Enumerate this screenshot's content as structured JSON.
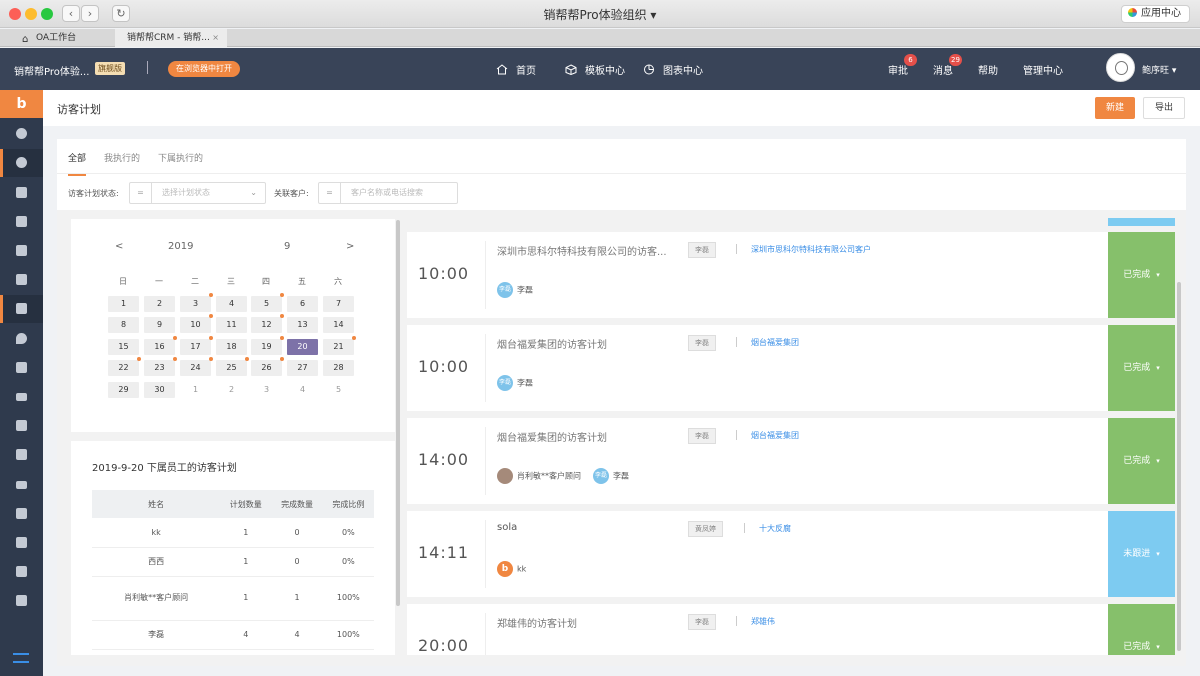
{
  "window": {
    "title": "销帮帮Pro体验组织",
    "app_center": "应用中心"
  },
  "tabs": [
    {
      "label": "OA工作台"
    },
    {
      "label": "销帮帮CRM - 销帮..."
    }
  ],
  "header": {
    "org": "销帮帮Pro体验...",
    "badge": "旗舰版",
    "open_browser": "在浏览器中打开",
    "nav": [
      {
        "label": "首页"
      },
      {
        "label": "模板中心"
      },
      {
        "label": "图表中心"
      }
    ],
    "approval": {
      "label": "审批",
      "count": "6"
    },
    "messages": {
      "label": "消息",
      "count": "29"
    },
    "help": "帮助",
    "admin": "管理中心",
    "user": "鲍序旺"
  },
  "page": {
    "title": "访客计划",
    "new_btn": "新建",
    "export_btn": "导出"
  },
  "view_tabs": [
    "全部",
    "我执行的",
    "下属执行的"
  ],
  "filters": {
    "status_label": "访客计划状态:",
    "status_placeholder": "选择计划状态",
    "client_label": "关联客户:",
    "client_placeholder": "客户名称或电话搜索",
    "eq": "="
  },
  "calendar": {
    "prev": "<",
    "next": ">",
    "year": "2019",
    "month": "9",
    "weekdays": [
      "日",
      "一",
      "二",
      "三",
      "四",
      "五",
      "六"
    ],
    "days": [
      [
        "1",
        "2",
        "3",
        "4",
        "5",
        "6",
        "7"
      ],
      [
        "8",
        "9",
        "10",
        "11",
        "12",
        "13",
        "14"
      ],
      [
        "15",
        "16",
        "17",
        "18",
        "19",
        "20",
        "21"
      ],
      [
        "22",
        "23",
        "24",
        "25",
        "26",
        "27",
        "28"
      ],
      [
        "29",
        "30",
        "1",
        "2",
        "3",
        "4",
        "5"
      ]
    ],
    "selected": "20"
  },
  "stats": {
    "title": "2019-9-20 下属员工的访客计划",
    "headers": [
      "姓名",
      "计划数量",
      "完成数量",
      "完成比例"
    ],
    "rows": [
      [
        "kk",
        "1",
        "0",
        "0%"
      ],
      [
        "西西",
        "1",
        "0",
        "0%"
      ],
      [
        "肖利敏**客户顾问",
        "1",
        "1",
        "100%"
      ],
      [
        "李磊",
        "4",
        "4",
        "100%"
      ]
    ]
  },
  "visits": [
    {
      "time": "10:00",
      "title": "深圳市思科尔特科技有限公司的访客...",
      "owner": "李磊",
      "client": "深圳市思科尔特科技有限公司客户",
      "people": [
        {
          "avatar": "李磊",
          "name": "李磊"
        }
      ],
      "status": "已完成"
    },
    {
      "time": "10:00",
      "title": "烟台福爱集团的访客计划",
      "owner": "李磊",
      "client": "烟台福爱集团",
      "people": [
        {
          "avatar": "李磊",
          "name": "李磊"
        }
      ],
      "status": "已完成"
    },
    {
      "time": "14:00",
      "title": "烟台福爱集团的访客计划",
      "owner": "李磊",
      "client": "烟台福爱集团",
      "people": [
        {
          "avatar": "",
          "name": "肖利敏**客户顾问"
        },
        {
          "avatar": "李磊",
          "name": "李磊"
        }
      ],
      "status": "已完成"
    },
    {
      "time": "14:11",
      "title": "sola",
      "owner": "黄凤婷",
      "client": "十大反腐",
      "people": [
        {
          "avatar": "b",
          "name": "kk"
        }
      ],
      "status": "未跟进"
    },
    {
      "time": "20:00",
      "title": "郑雄伟的访客计划",
      "owner": "李磊",
      "client": "郑雄伟",
      "people": [],
      "status": "已完成"
    }
  ],
  "colors": {
    "accent": "#f08741",
    "header": "#394458",
    "done": "#86c06b",
    "pending": "#7dcbf1",
    "selected_day": "#7d72a8"
  }
}
